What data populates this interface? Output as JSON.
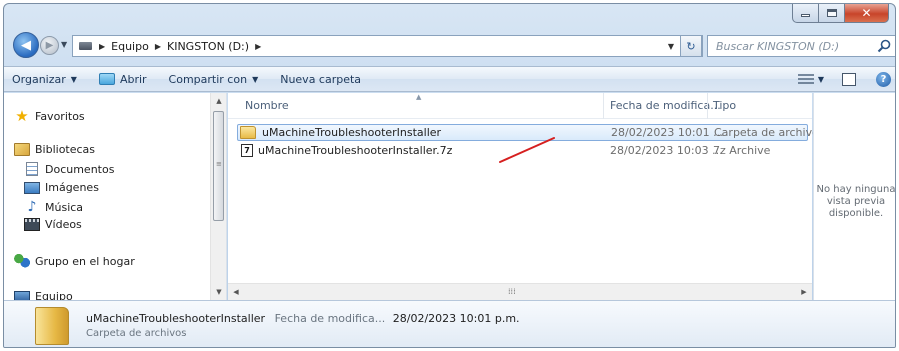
{
  "window": {
    "colors": {
      "frame": "#b9cfe7",
      "close": "#c8442a",
      "selection": "#d9eafb",
      "annotation": "#d62020"
    }
  },
  "address_bar": {
    "crumbs": [
      "Equipo",
      "KINGSTON (D:)"
    ]
  },
  "search": {
    "placeholder": "Buscar KINGSTON (D:)"
  },
  "toolbar": {
    "organize": "Organizar",
    "open": "Abrir",
    "share": "Compartir con",
    "new_folder": "Nueva carpeta"
  },
  "nav_pane": {
    "favorites": "Favoritos",
    "libraries": "Bibliotecas",
    "library_items": [
      "Documentos",
      "Imágenes",
      "Música",
      "Vídeos"
    ],
    "homegroup": "Grupo en el hogar",
    "computer": "Equipo"
  },
  "columns": {
    "name": "Nombre",
    "date": "Fecha de modifica...",
    "type": "Tipo"
  },
  "files": [
    {
      "name": "uMachineTroubleshooterInstaller",
      "date": "28/02/2023 10:01 ...",
      "type": "Carpeta de archivos",
      "icon": "folder-icon",
      "selected": true
    },
    {
      "name": "uMachineTroubleshooterInstaller.7z",
      "date": "28/02/2023 10:03 ...",
      "type": "7z Archive",
      "icon": "7z-archive-icon",
      "selected": false
    }
  ],
  "preview": {
    "text": "No hay ninguna\nvista previa\ndisponible."
  },
  "details": {
    "name": "uMachineTroubleshooterInstaller",
    "date_label": "Fecha de modifica...",
    "date_value": "28/02/2023 10:01 p.m.",
    "type": "Carpeta de archivos"
  }
}
